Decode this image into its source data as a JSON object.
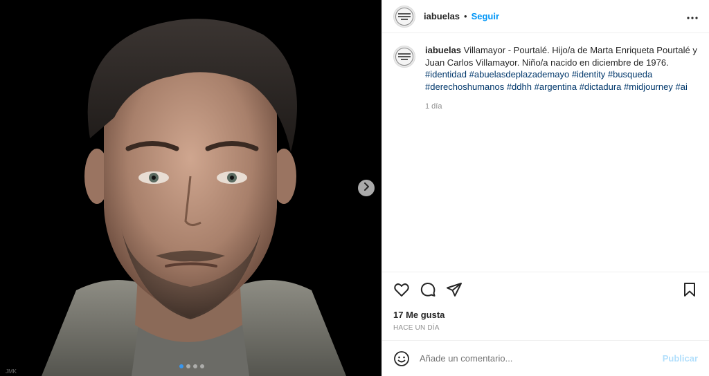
{
  "media": {
    "image_icon": "portrait-image",
    "next_icon": "chevron-right-icon",
    "carousel": {
      "count": 4,
      "active_index": 0
    }
  },
  "header": {
    "username": "iabuelas",
    "separator": "•",
    "follow_label": "Seguir",
    "more_icon": "more-horizontal-icon"
  },
  "caption": {
    "username": "iabuelas",
    "text": " Villamayor - Pourtalé. Hijo/a de Marta Enriqueta Pourtalé y Juan Carlos Villamayor. Niño/a nacido en diciembre de 1976. ",
    "hashtags": [
      "#identidad",
      "#abuelasdeplazademayo",
      "#identity",
      "#busqueda",
      "#derechoshumanos",
      "#ddhh",
      "#argentina",
      "#dictadura",
      "#midjourney",
      "#ai"
    ],
    "time": "1 día"
  },
  "actions": {
    "like_icon": "heart-icon",
    "comment_icon": "comment-icon",
    "share_icon": "send-icon",
    "save_icon": "bookmark-icon",
    "likes": "17 Me gusta",
    "posted": "HACE UN DÍA"
  },
  "comment": {
    "emoji_icon": "emoji-icon",
    "placeholder": "Añade un comentario...",
    "publish_label": "Publicar"
  },
  "colors": {
    "accent": "#0095f6",
    "hashtag": "#00376b",
    "publish_disabled": "#b2dffc",
    "muted": "#8e8e8e"
  }
}
